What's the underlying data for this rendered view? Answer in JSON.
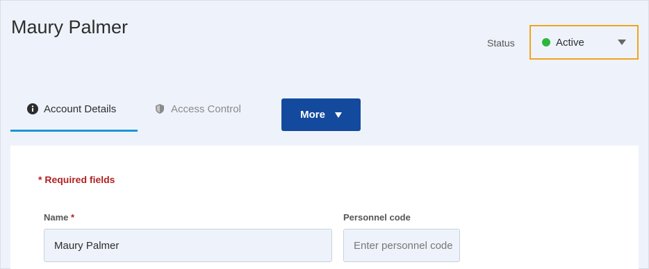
{
  "page": {
    "title": "Maury Palmer"
  },
  "status": {
    "label": "Status",
    "value": "Active",
    "dot_color": "#2db83d",
    "highlight_color": "#f0a31c"
  },
  "tabs": [
    {
      "label": "Account Details",
      "icon": "info-circle-icon",
      "active": true
    },
    {
      "label": "Access Control",
      "icon": "shield-icon",
      "active": false
    }
  ],
  "more_button": {
    "label": "More",
    "icon": "caret-down-icon",
    "color": "#134a9e"
  },
  "form": {
    "required_note": "* Required fields",
    "name": {
      "label": "Name",
      "required_mark": "*",
      "value": "Maury Palmer"
    },
    "personnel_code": {
      "label": "Personnel code",
      "placeholder": "Enter personnel code",
      "value": ""
    }
  }
}
